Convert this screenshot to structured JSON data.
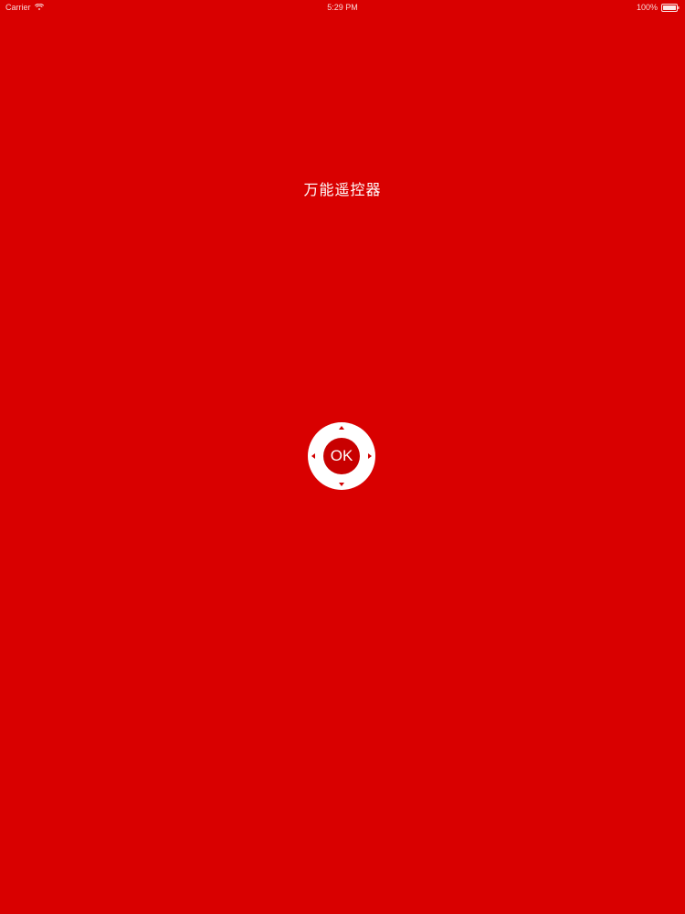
{
  "status_bar": {
    "carrier": "Carrier",
    "wifi_icon": "wifi-icon",
    "time": "5:29 PM",
    "battery_percent": "100%",
    "battery_icon": "battery-icon"
  },
  "app": {
    "title": "万能遥控器",
    "background_color": "#d90000"
  },
  "remote": {
    "ok_label": "OK",
    "pad_color": "#ffffff",
    "ok_color": "#c80000",
    "arrows": [
      "up-arrow-icon",
      "down-arrow-icon",
      "left-arrow-icon",
      "right-arrow-icon"
    ]
  }
}
